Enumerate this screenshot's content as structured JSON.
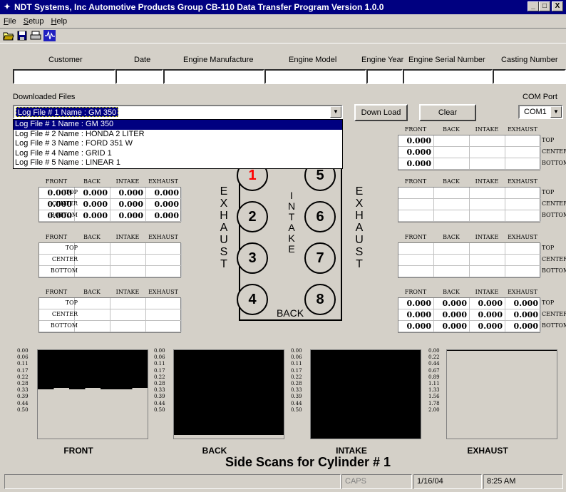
{
  "window": {
    "title": "NDT Systems, Inc  Automotive Products Group   CB-110 Data Transfer Program  Version 1.0.0",
    "min": "_",
    "max": "□",
    "close": "X"
  },
  "menu": [
    "File",
    "Setup",
    "Help"
  ],
  "toolbar": [
    "open-icon",
    "save-icon",
    "print-icon",
    "waveform-icon"
  ],
  "header": {
    "customer": "Customer",
    "date": "Date",
    "engine_manufacture": "Engine Manufacture",
    "engine_model": "Engine Model",
    "engine_year": "Engine Year",
    "engine_serial": "Engine Serial Number",
    "casting_number": "Casting Number"
  },
  "downloaded_files_label": "Downloaded Files",
  "selected_file": "Log File # 1   Name : GM 350",
  "files": [
    "Log File # 1   Name : GM 350",
    "Log File # 2   Name : HONDA 2 LITER",
    "Log File # 3   Name : FORD 351 W",
    "Log File # 4   Name : GRID 1",
    "Log File # 5   Name : LINEAR 1"
  ],
  "buttons": {
    "download": "Down Load",
    "clear": "Clear"
  },
  "com_port": {
    "label": "COM Port",
    "value": "COM1"
  },
  "cols": [
    "FRONT",
    "BACK",
    "INTAKE",
    "EXHAUST"
  ],
  "rows": [
    "TOP",
    "CENTER",
    "BOTTOM"
  ],
  "left_groups": [
    {
      "values": [
        [
          "0.000",
          "0.000",
          "0.000",
          "0.000"
        ],
        [
          "0.000",
          "0.000",
          "0.000",
          "0.000"
        ],
        [
          "0.000",
          "0.000",
          "0.000",
          "0.000"
        ]
      ]
    },
    {
      "values": [
        [
          "",
          "",
          "",
          ""
        ],
        [
          "",
          "",
          "",
          ""
        ],
        [
          "",
          "",
          "",
          ""
        ]
      ]
    },
    {
      "values": [
        [
          "",
          "",
          "",
          ""
        ],
        [
          "",
          "",
          "",
          ""
        ],
        [
          "",
          "",
          "",
          ""
        ]
      ]
    }
  ],
  "right_groups": [
    {
      "values": [
        [
          "0.000",
          "",
          "",
          ""
        ],
        [
          "0.000",
          "",
          "",
          ""
        ],
        [
          "0.000",
          "",
          "",
          ""
        ]
      ]
    },
    {
      "values": [
        [
          "",
          "",
          "",
          ""
        ],
        [
          "",
          "",
          "",
          ""
        ],
        [
          "",
          "",
          "",
          ""
        ]
      ]
    },
    {
      "values": [
        [
          "",
          "",
          "",
          ""
        ],
        [
          "",
          "",
          "",
          ""
        ],
        [
          "",
          "",
          "",
          ""
        ]
      ]
    },
    {
      "values": [
        [
          "0.000",
          "0.000",
          "0.000",
          "0.000"
        ],
        [
          "0.000",
          "0.000",
          "0.000",
          "0.000"
        ],
        [
          "0.000",
          "0.000",
          "0.000",
          "0.000"
        ]
      ]
    }
  ],
  "engine": {
    "exhaust_left": [
      "E",
      "X",
      "H",
      "A",
      "U",
      "S",
      "T"
    ],
    "intake": [
      "I",
      "N",
      "T",
      "A",
      "K",
      "E"
    ],
    "exhaust_right": [
      "E",
      "X",
      "H",
      "A",
      "U",
      "S",
      "T"
    ],
    "back": "BACK",
    "cylinders": [
      "1",
      "5",
      "2",
      "6",
      "3",
      "7",
      "4",
      "8"
    ],
    "active_cylinder": "1",
    "active_color": "#ff0000"
  },
  "scan_ticks_a": [
    "0.00",
    "0.06",
    "0.11",
    "0.17",
    "0.22",
    "0.28",
    "0.33",
    "0.39",
    "0.44",
    "0.50"
  ],
  "scan_ticks_b": [
    "0.00",
    "0.22",
    "0.44",
    "0.67",
    "0.89",
    "1.11",
    "1.33",
    "1.56",
    "1.78",
    "2.00"
  ],
  "scan_labels": [
    "FRONT",
    "BACK",
    "INTAKE",
    "EXHAUST"
  ],
  "side_scan_title": "Side Scans for Cylinder # 1",
  "status": {
    "caps": "CAPS",
    "date": "1/16/04",
    "time": "8:25 AM"
  }
}
